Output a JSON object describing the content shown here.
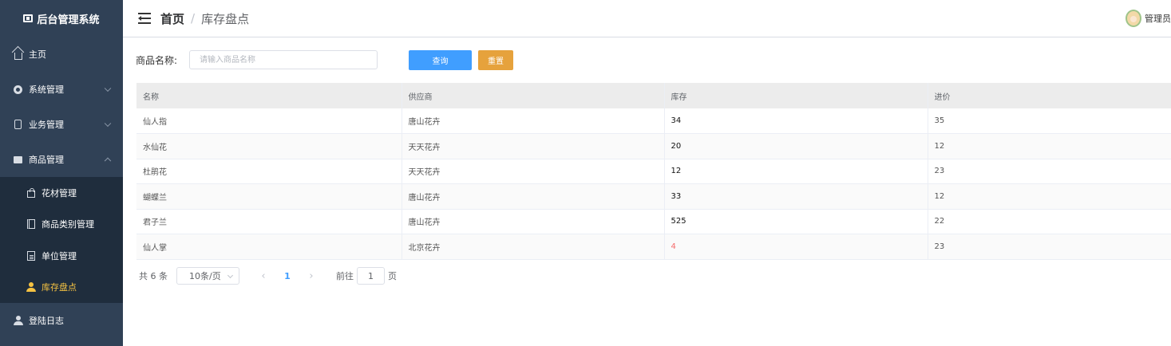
{
  "app": {
    "title": "后台管理系统"
  },
  "sidebar": {
    "items": [
      {
        "label": "主页",
        "icon": "home-icon"
      },
      {
        "label": "系统管理",
        "icon": "gear-icon",
        "expanded": false
      },
      {
        "label": "业务管理",
        "icon": "phone-icon",
        "expanded": false
      },
      {
        "label": "商品管理",
        "icon": "box-icon",
        "expanded": true
      }
    ],
    "sub_items": [
      {
        "label": "花材管理",
        "icon": "bag-icon"
      },
      {
        "label": "商品类别管理",
        "icon": "book-icon"
      },
      {
        "label": "单位管理",
        "icon": "doc-icon"
      },
      {
        "label": "库存盘点",
        "icon": "user-icon",
        "active": true
      }
    ],
    "last_item": {
      "label": "登陆日志",
      "icon": "user-icon"
    },
    "active_color": "#f5c242"
  },
  "header": {
    "breadcrumb_home": "首页",
    "breadcrumb_sep": "/",
    "breadcrumb_current": "库存盘点",
    "user_name": "管理员"
  },
  "search": {
    "label": "商品名称:",
    "placeholder": "请输入商品名称",
    "value": "",
    "query_label": "查询",
    "reset_label": "重置"
  },
  "table": {
    "columns": [
      "名称",
      "供应商",
      "库存",
      "进价"
    ],
    "rows": [
      {
        "name": "仙人指",
        "supplier": "唐山花卉",
        "stock": "34",
        "price": "35",
        "warn": false
      },
      {
        "name": "水仙花",
        "supplier": "天天花卉",
        "stock": "20",
        "price": "12",
        "warn": false
      },
      {
        "name": "杜鹃花",
        "supplier": "天天花卉",
        "stock": "12",
        "price": "23",
        "warn": false
      },
      {
        "name": "蝴蝶兰",
        "supplier": "唐山花卉",
        "stock": "33",
        "price": "12",
        "warn": false
      },
      {
        "name": "君子兰",
        "supplier": "唐山花卉",
        "stock": "525",
        "price": "22",
        "warn": false
      },
      {
        "name": "仙人掌",
        "supplier": "北京花卉",
        "stock": "4",
        "price": "23",
        "warn": true
      }
    ]
  },
  "pagination": {
    "total_text": "共 6 条",
    "page_size": "10条/页",
    "prev": "‹",
    "current_page": "1",
    "next": "›",
    "goto_label": "前往",
    "goto_value": "1",
    "page_unit": "页"
  },
  "colors": {
    "sidebar_bg": "#304156",
    "primary": "#409eff",
    "warning": "#e6a23c",
    "danger": "#f56c6c"
  }
}
